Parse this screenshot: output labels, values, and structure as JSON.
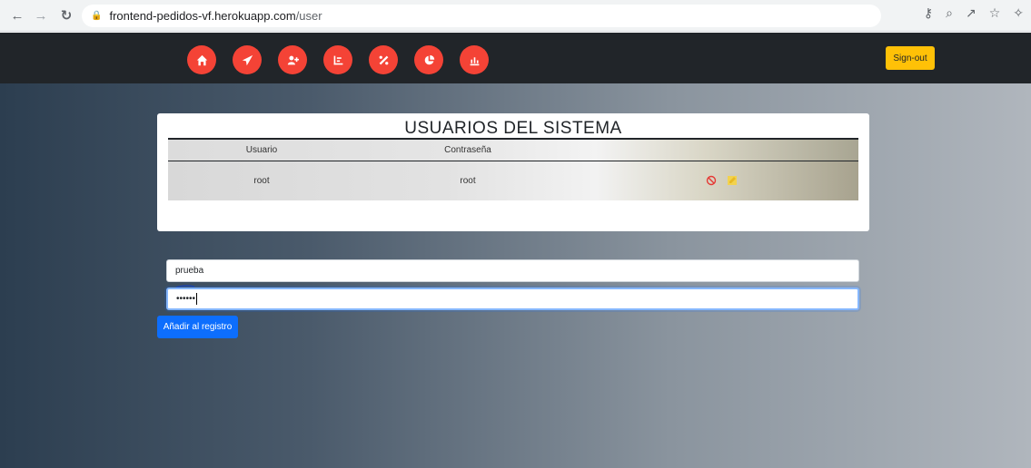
{
  "browser": {
    "url_host": "frontend-pedidos-vf.herokuapp.com",
    "url_path": "/user"
  },
  "nav": {
    "buttons": [
      {
        "icon": "home-icon"
      },
      {
        "icon": "paper-plane-icon"
      },
      {
        "icon": "user-plus-icon"
      },
      {
        "icon": "list-chart-icon"
      },
      {
        "icon": "percent-icon"
      },
      {
        "icon": "pie-chart-icon"
      },
      {
        "icon": "bar-chart-icon"
      }
    ],
    "signout_label": "Sign-out",
    "button_color": "#f44336",
    "signout_color": "#ffc107"
  },
  "users_card": {
    "title": "USUARIOS DEL SISTEMA",
    "columns": [
      "Usuario",
      "Contraseña"
    ],
    "rows": [
      {
        "usuario": "root",
        "contrasena": "root"
      }
    ]
  },
  "form": {
    "username_value": "prueba",
    "password_value": "••••••",
    "add_button_label": "Añadir al registro",
    "add_button_color": "#0d6efd"
  }
}
